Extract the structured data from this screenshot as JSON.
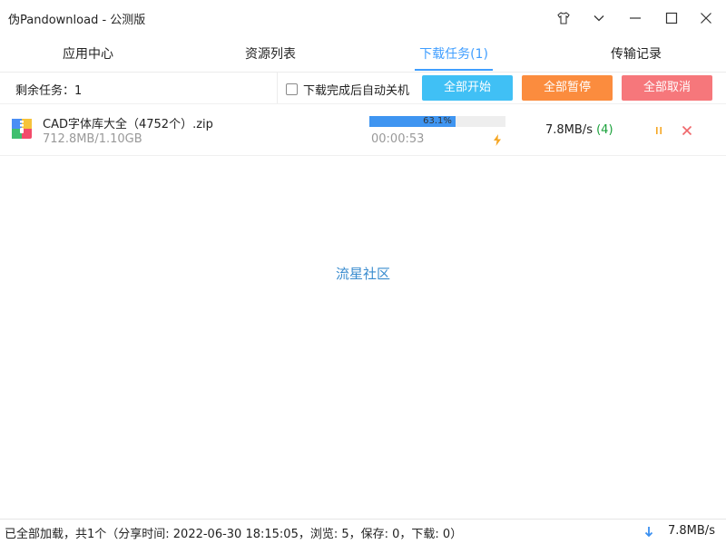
{
  "window": {
    "title": "伪Pandownload - 公测版",
    "controls": [
      "shirt-icon",
      "chevron-down-icon",
      "minimize-icon",
      "maximize-icon",
      "close-icon"
    ]
  },
  "tabs": [
    {
      "label": "应用中心",
      "active": false
    },
    {
      "label": "资源列表",
      "active": false
    },
    {
      "label": "下载任务(1)",
      "active": true
    },
    {
      "label": "传输记录",
      "active": false
    }
  ],
  "toolbar": {
    "remaining": "剩余任务：1",
    "auto_shutdown_label": "下载完成后自动关机",
    "auto_shutdown_checked": false,
    "start_all": "全部开始",
    "pause_all": "全部暂停",
    "cancel_all": "全部取消"
  },
  "tasks": [
    {
      "name": "CAD字体库大全（4752个）.zip",
      "size": "712.8MB/1.10GB",
      "progress_text": "63.1%",
      "progress_fraction": 0.631,
      "elapsed": "00:00:53",
      "speed": "7.8MB/s",
      "threads": "(4)"
    }
  ],
  "center_link": "流星社区",
  "statusbar": {
    "text": "已全部加载，共1个（分享时间: 2022-06-30 18:15:05，浏览: 5，保存: 0，下载: 0）",
    "speed": "7.8MB/s"
  },
  "colors": {
    "accent": "#409eff",
    "start": "#40c0f5",
    "pause": "#fb8c3e",
    "cancel": "#f6777b",
    "progress": "#3f95f1",
    "threads": "#19a13a"
  }
}
